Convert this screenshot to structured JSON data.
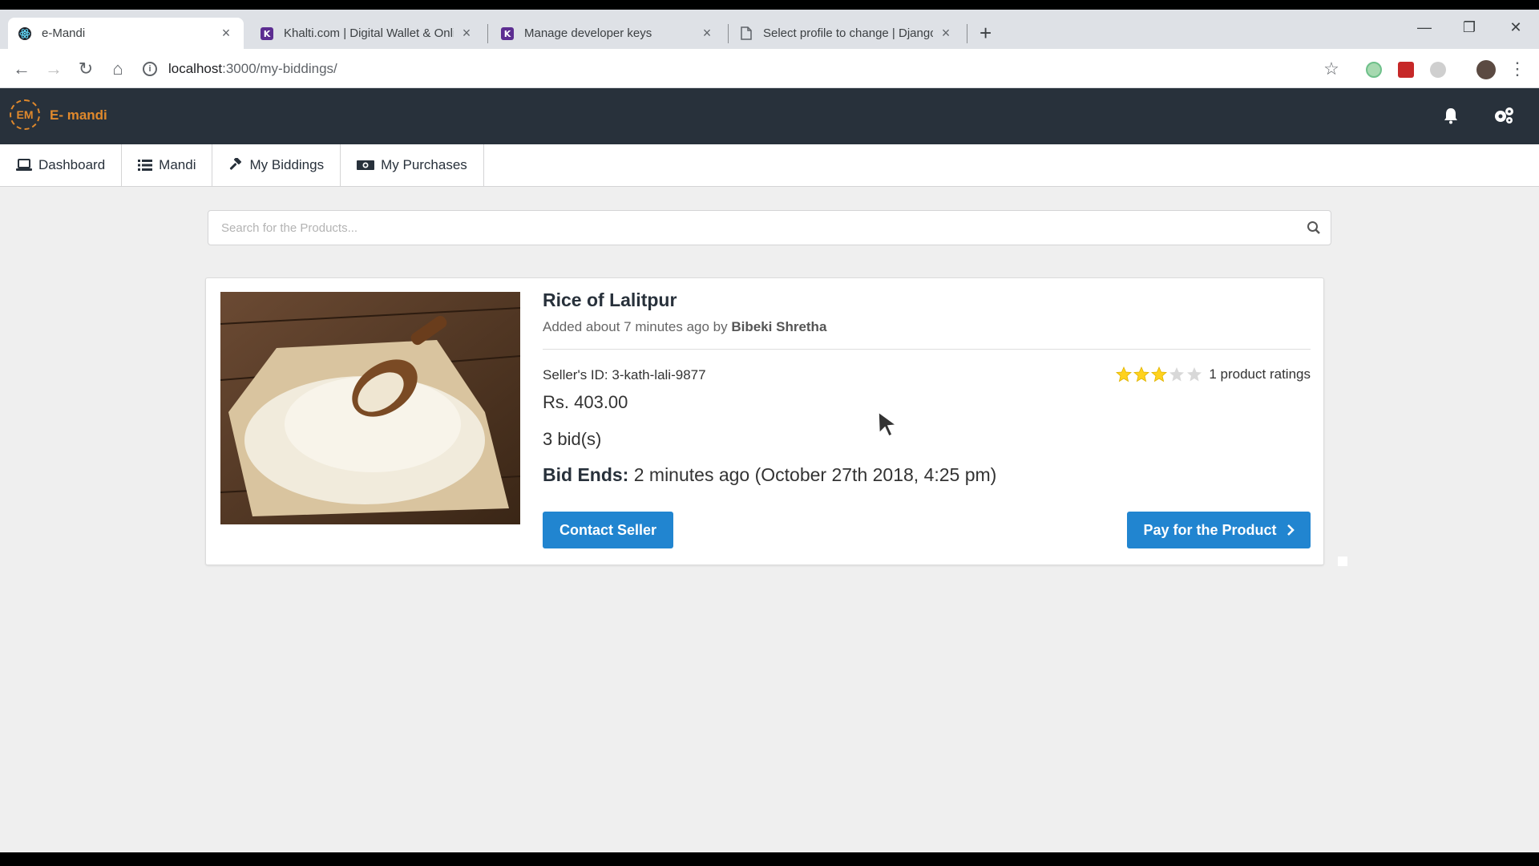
{
  "browser": {
    "tabs": [
      {
        "title": "e-Mandi",
        "icon": "react-icon",
        "active": true
      },
      {
        "title": "Khalti.com | Digital Wallet & Onli",
        "icon": "khalti-icon",
        "active": false
      },
      {
        "title": "Manage developer keys",
        "icon": "khalti-icon",
        "active": false
      },
      {
        "title": "Select profile to change | Django",
        "icon": "page-icon",
        "active": false
      }
    ],
    "url_host": "localhost",
    "url_path": ":3000/my-biddings/"
  },
  "app": {
    "logo_mark": "EM",
    "logo_text": "E- mandi",
    "accent": "#e0892c",
    "navbar_bg": "#28313b"
  },
  "nav": {
    "items": [
      {
        "label": "Dashboard",
        "icon": "laptop-icon"
      },
      {
        "label": "Mandi",
        "icon": "list-icon"
      },
      {
        "label": "My Biddings",
        "icon": "gavel-icon"
      },
      {
        "label": "My Purchases",
        "icon": "money-icon"
      }
    ]
  },
  "search": {
    "placeholder": "Search for the Products..."
  },
  "product": {
    "name": "Rice of Lalitpur",
    "added_prefix": "Added about 7 minutes ago by",
    "added_by": "Bibeki Shretha",
    "seller_id": "Seller's ID: 3-kath-lali-9877",
    "price": "Rs. 403.00",
    "bids": "3 bid(s)",
    "bid_ends_label": "Bid Ends:",
    "bid_ends_value": "2 minutes ago (October 27th 2018, 4:25 pm)",
    "rating_stars": 3,
    "rating_max": 5,
    "rating_text": "1 product ratings"
  },
  "buttons": {
    "contact": "Contact Seller",
    "pay": "Pay for the Product",
    "color": "#2185d0"
  }
}
